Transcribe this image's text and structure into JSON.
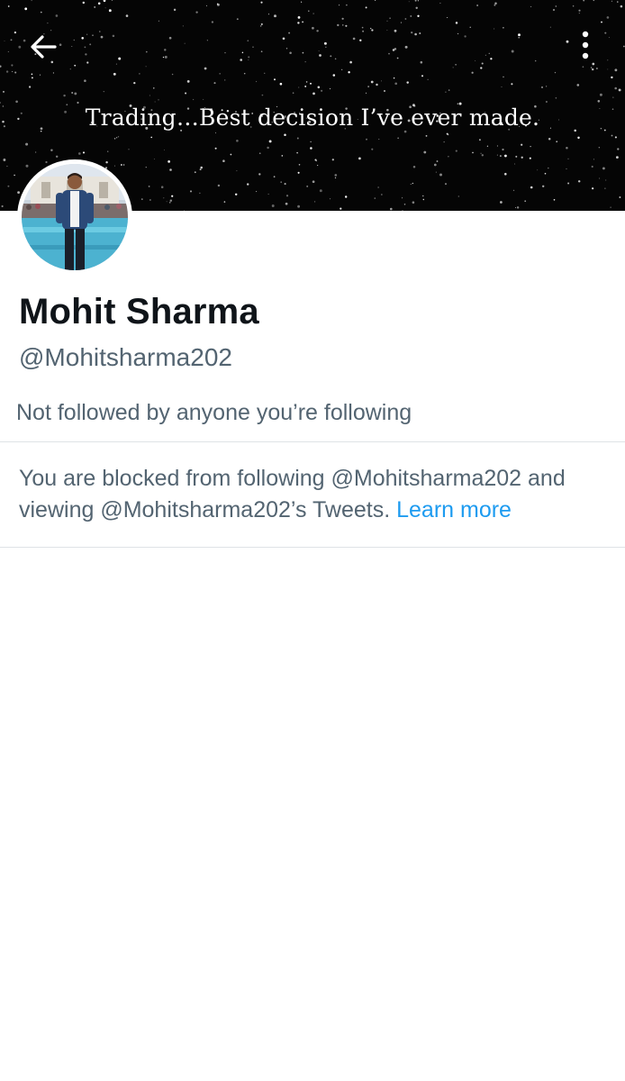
{
  "header": {
    "back_icon": "arrow-left-icon",
    "more_icon": "vertical-dots-icon",
    "banner_text": "Trading…Best decision I’ve ever made."
  },
  "profile": {
    "name": "Mohit Sharma",
    "handle": "@Mohitsharma202",
    "followed_by": "Not followed by anyone you’re following"
  },
  "blocked_notice": {
    "text": "You are blocked from following @Mohitsharma202 and viewing @Mohitsharma202’s Tweets.",
    "link_label": "Learn more"
  },
  "colors": {
    "link": "#1d9bf0",
    "secondary_text": "#536471",
    "primary_text": "#0f1419",
    "banner_bg": "#050505"
  }
}
